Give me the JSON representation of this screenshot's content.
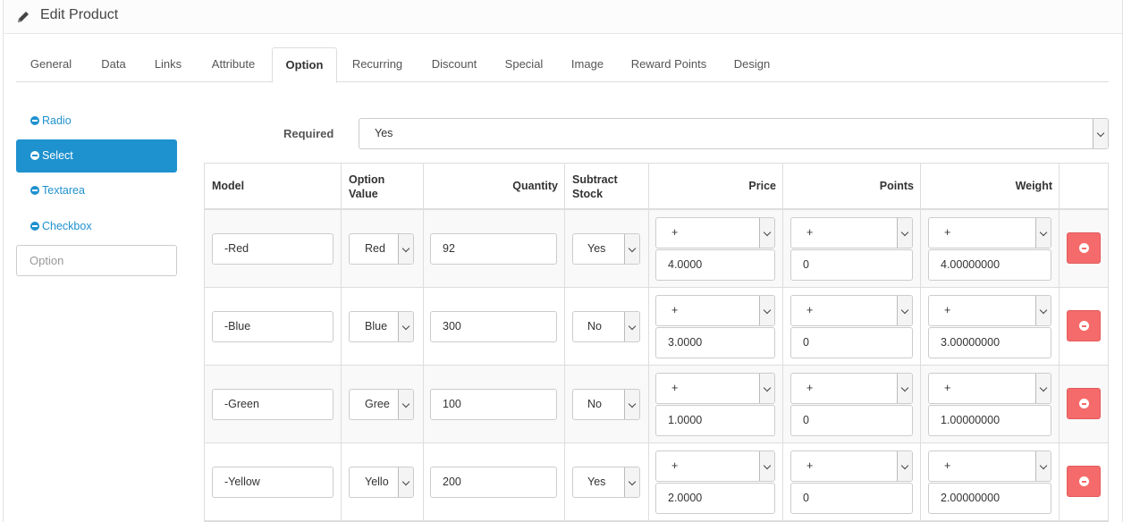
{
  "header": {
    "title": "Edit Product",
    "icon": "pencil-icon"
  },
  "tabs": [
    {
      "label": "General"
    },
    {
      "label": "Data"
    },
    {
      "label": "Links"
    },
    {
      "label": "Attribute"
    },
    {
      "label": "Option",
      "active": true
    },
    {
      "label": "Recurring"
    },
    {
      "label": "Discount"
    },
    {
      "label": "Special"
    },
    {
      "label": "Image"
    },
    {
      "label": "Reward Points"
    },
    {
      "label": "Design"
    }
  ],
  "sidebar": {
    "items": [
      {
        "label": "Radio"
      },
      {
        "label": "Select",
        "active": true
      },
      {
        "label": "Textarea"
      },
      {
        "label": "Checkbox"
      }
    ],
    "option_placeholder": "Option"
  },
  "required": {
    "label": "Required",
    "value": "Yes"
  },
  "table": {
    "headers": {
      "model": "Model",
      "option_value_1": "Option",
      "option_value_2": "Value",
      "quantity": "Quantity",
      "subtract_1": "Subtract",
      "subtract_2": "Stock",
      "price": "Price",
      "points": "Points",
      "weight": "Weight"
    },
    "rows": [
      {
        "model": "-Red",
        "option_value": "Red",
        "quantity": "92",
        "subtract": "Yes",
        "price_prefix": "+",
        "price": "4.0000",
        "points_prefix": "+",
        "points": "0",
        "weight_prefix": "+",
        "weight": "4.00000000"
      },
      {
        "model": "-Blue",
        "option_value": "Blue",
        "quantity": "300",
        "subtract": "No",
        "price_prefix": "+",
        "price": "3.0000",
        "points_prefix": "+",
        "points": "0",
        "weight_prefix": "+",
        "weight": "3.00000000"
      },
      {
        "model": "-Green",
        "option_value": "Gree",
        "quantity": "100",
        "subtract": "No",
        "price_prefix": "+",
        "price": "1.0000",
        "points_prefix": "+",
        "points": "0",
        "weight_prefix": "+",
        "weight": "1.00000000"
      },
      {
        "model": "-Yellow",
        "option_value": "Yello",
        "quantity": "200",
        "subtract": "Yes",
        "price_prefix": "+",
        "price": "2.0000",
        "points_prefix": "+",
        "points": "0",
        "weight_prefix": "+",
        "weight": "2.00000000"
      }
    ]
  },
  "colors": {
    "accent": "#1e91cf",
    "danger": "#f56b6b"
  }
}
